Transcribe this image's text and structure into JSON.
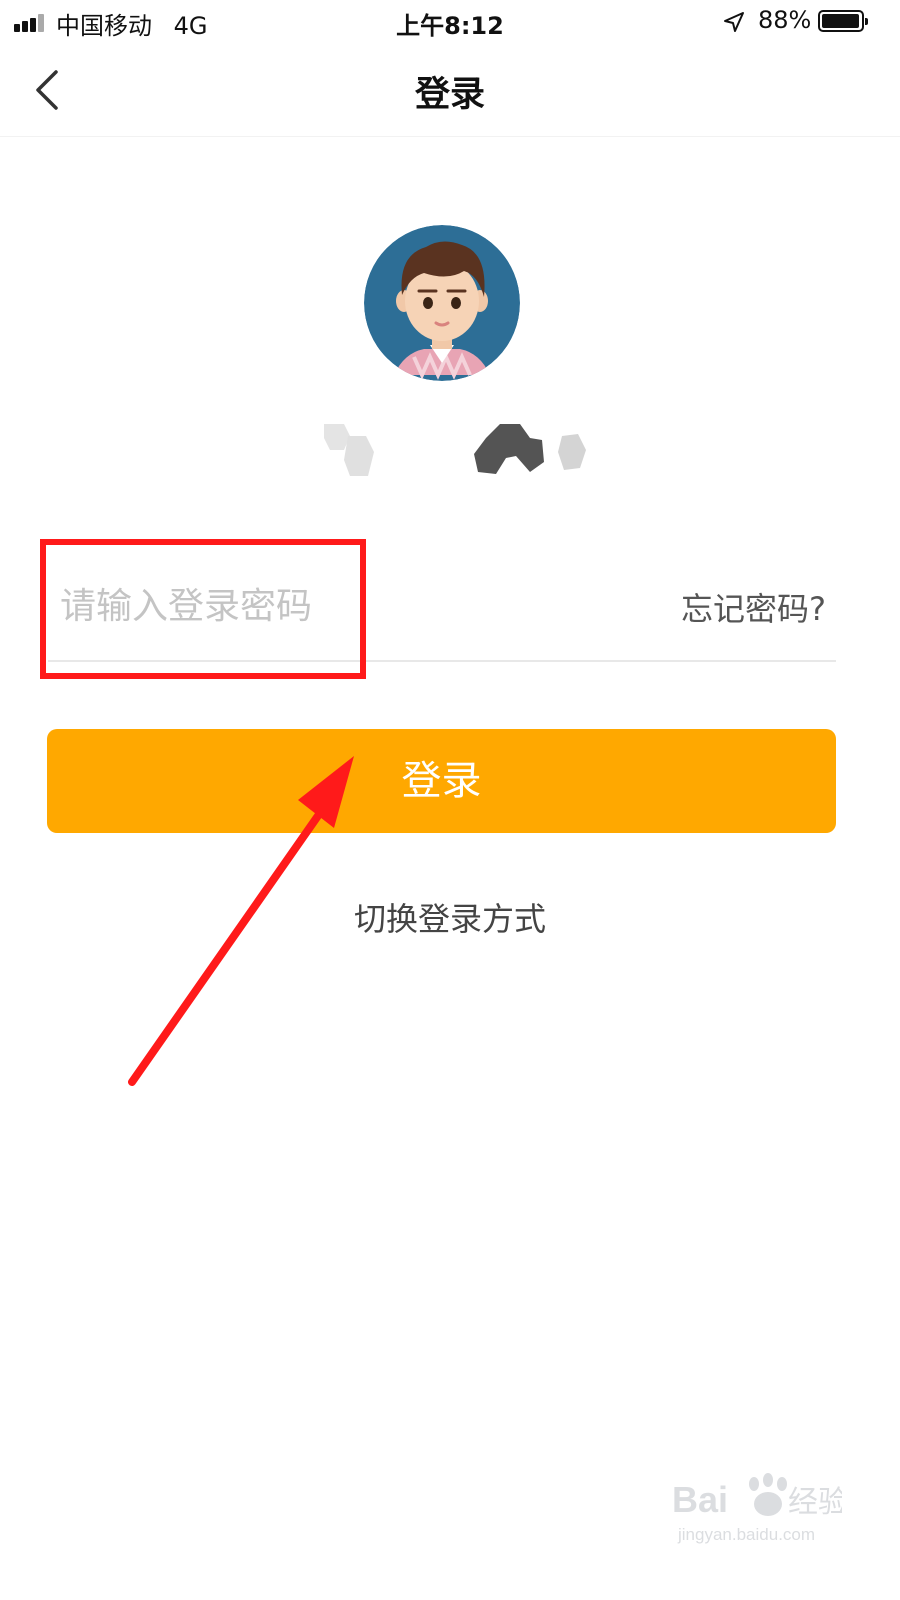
{
  "status_bar": {
    "carrier": "中国移动",
    "network": "4G",
    "time": "上午8:12",
    "battery": "88%",
    "battery_level": 0.88
  },
  "nav": {
    "title": "登录",
    "back_icon": "chevron-left-icon"
  },
  "login": {
    "password_placeholder": "请输入登录密码",
    "forgot_label": "忘记密码?",
    "button_label": "登录",
    "switch_label": "切换登录方式"
  },
  "colors": {
    "accent": "#ffa800",
    "annotation": "#ff1a1a"
  },
  "watermark": {
    "logo_text": "Bai 经验",
    "url": "jingyan.baidu.com"
  }
}
